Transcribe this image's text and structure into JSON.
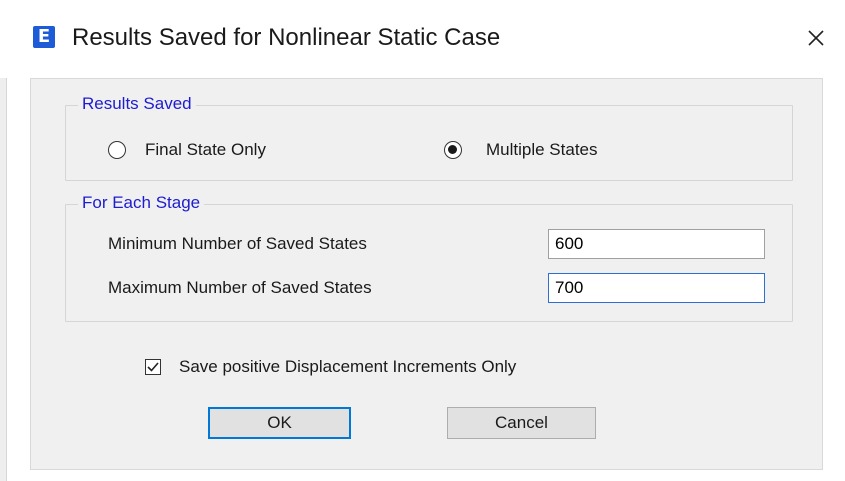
{
  "window": {
    "app_icon_letter": "E",
    "title": "Results Saved for Nonlinear Static Case",
    "close_glyph": "×"
  },
  "results_saved": {
    "group_label": "Results Saved",
    "options": [
      {
        "label": "Final State Only",
        "checked": false
      },
      {
        "label": "Multiple States",
        "checked": true
      }
    ]
  },
  "for_each_stage": {
    "group_label": "For Each Stage",
    "min_label": "Minimum Number of Saved States",
    "min_value": "600",
    "max_label": "Maximum Number of Saved States",
    "max_value": "700"
  },
  "options": {
    "positive_increments_label": "Save positive Displacement Increments Only",
    "positive_increments_checked": true
  },
  "buttons": {
    "ok": "OK",
    "cancel": "Cancel"
  },
  "colors": {
    "group_label": "#1c1cd0",
    "app_icon_bg": "#1e5bd6",
    "default_button_border": "#0078d7"
  }
}
